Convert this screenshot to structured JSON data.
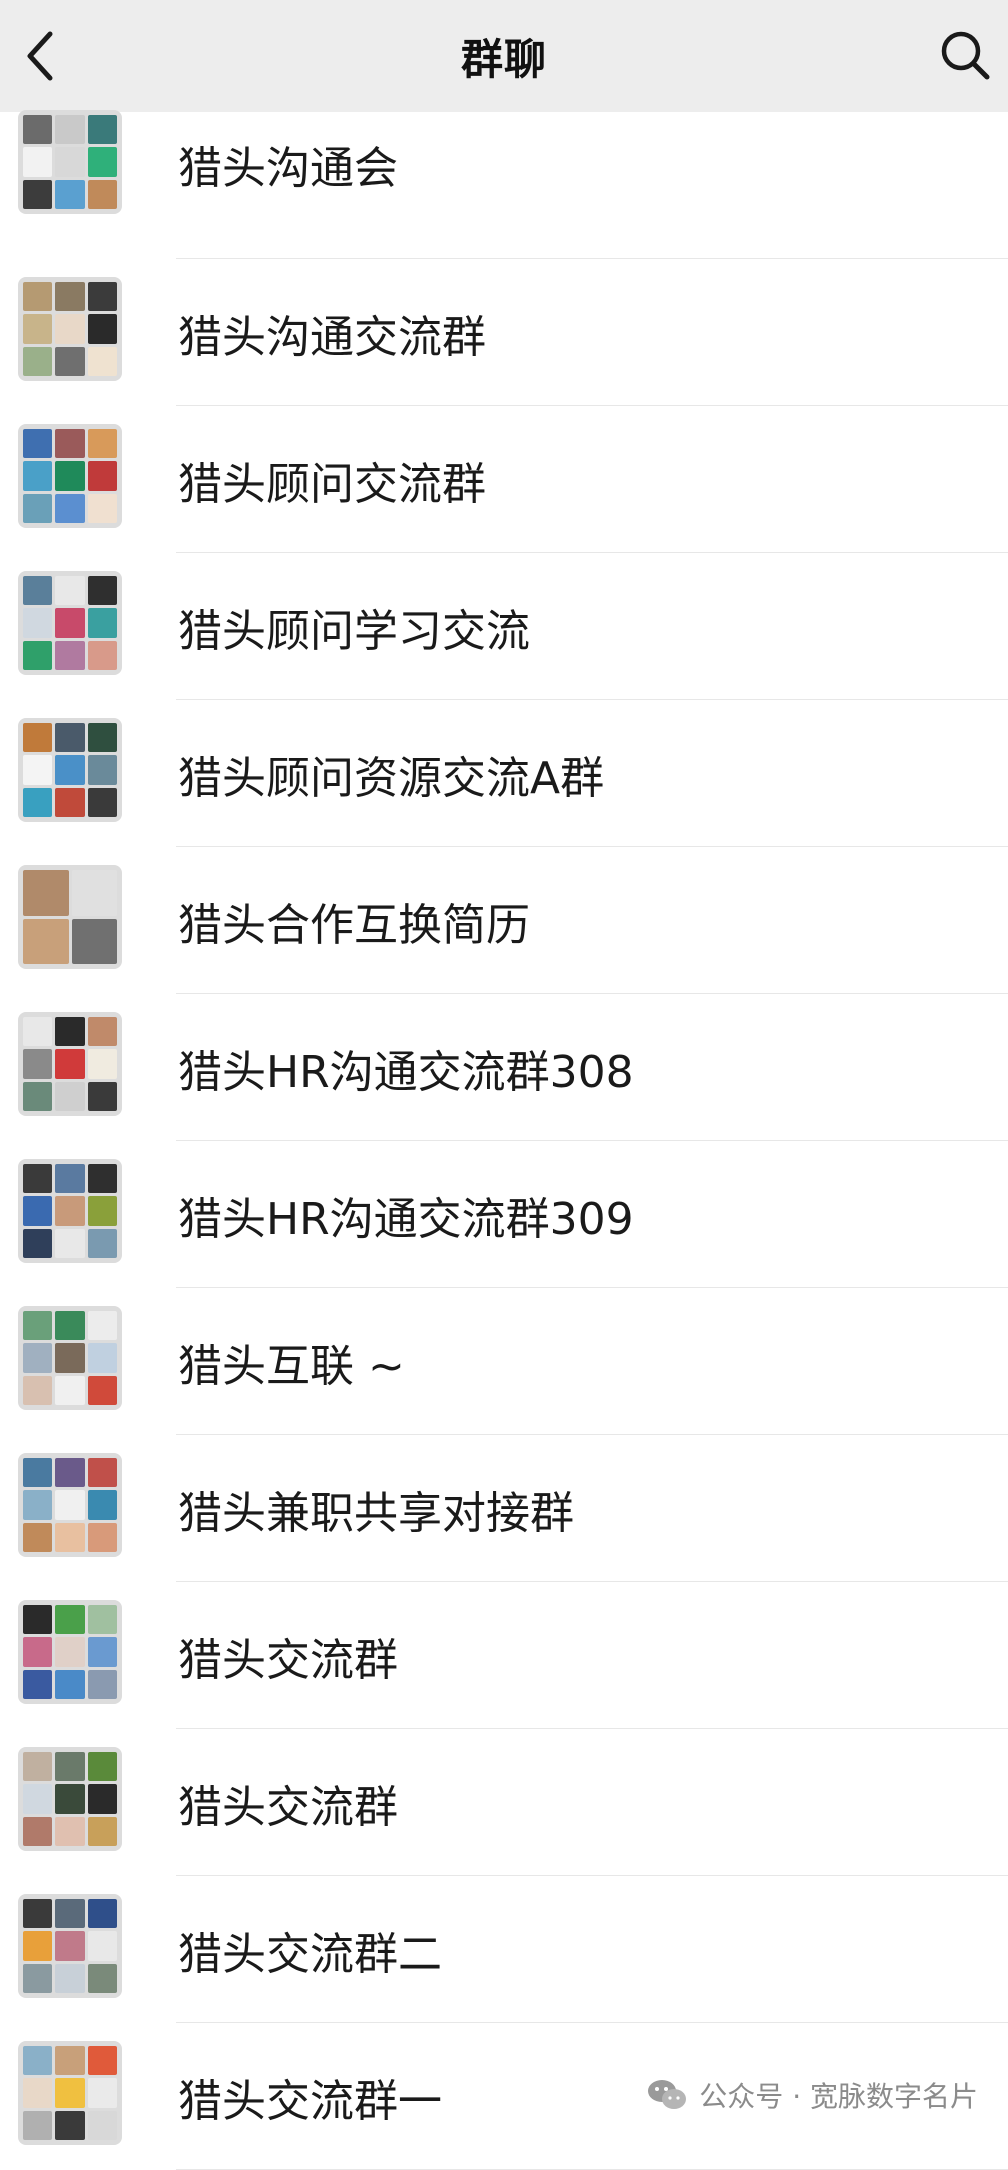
{
  "header": {
    "title": "群聊"
  },
  "groups": [
    {
      "name": "猎头沟通会",
      "colors": [
        "#6b6b6b",
        "#c9c9c9",
        "#3a7a7a",
        "#f2f2f2",
        "#d8d8d8",
        "#2fb07a",
        "#3c3c3c",
        "#5aa0d0",
        "#c08a5a"
      ]
    },
    {
      "name": "猎头沟通交流群",
      "colors": [
        "#b59a72",
        "#8a7a62",
        "#3b3b3b",
        "#c8b48a",
        "#e8d8c8",
        "#2a2a2a",
        "#9ab08a",
        "#6f6f6f",
        "#efe2d0"
      ]
    },
    {
      "name": "猎头顾问交流群",
      "colors": [
        "#3f6fb0",
        "#9a5a5a",
        "#d89a5a",
        "#4aa0c8",
        "#1f8a5a",
        "#c03a3a",
        "#6aa0b8",
        "#5b8fd0",
        "#f0e0d0"
      ]
    },
    {
      "name": "猎头顾问学习交流",
      "colors": [
        "#5a7f9a",
        "#e8e8e8",
        "#2f2f2f",
        "#d0d8e0",
        "#c84a6a",
        "#3aa0a0",
        "#2fa06a",
        "#b07aa0",
        "#d89a8a"
      ]
    },
    {
      "name": "猎头顾问资源交流A群",
      "colors": [
        "#c07a3a",
        "#4a5a6a",
        "#2f4f3f",
        "#f4f4f4",
        "#4a90c8",
        "#6a8a9a",
        "#39a0c0",
        "#c04a3a",
        "#3a3a3a"
      ]
    },
    {
      "name": "猎头合作互换简历",
      "colors": [
        "#b08a6a",
        "#e0e0e0",
        "#c8a07a",
        "#707070"
      ]
    },
    {
      "name": "猎头HR沟通交流群308",
      "colors": [
        "#e8e8e8",
        "#2a2a2a",
        "#c08a6a",
        "#8a8a8a",
        "#d03a3a",
        "#f0ebe0",
        "#6a8a7a",
        "#cfcfcf",
        "#3a3a3a"
      ]
    },
    {
      "name": "猎头HR沟通交流群309",
      "colors": [
        "#3a3a3a",
        "#5a7aa0",
        "#2f2f2f",
        "#3a6ab0",
        "#c89a7a",
        "#8aa03a",
        "#2f3f5a",
        "#e8e8e8",
        "#7a9ab0"
      ]
    },
    {
      "name": "猎头互联 ~",
      "colors": [
        "#6aa07a",
        "#3a8a5a",
        "#ececec",
        "#a0b0c0",
        "#7a6a5a",
        "#c0d0e0",
        "#d8c0b0",
        "#f0f0f0",
        "#d04a3a"
      ]
    },
    {
      "name": "猎头兼职共享对接群",
      "colors": [
        "#4a7aa0",
        "#6a5a8a",
        "#c0504a",
        "#8ab0c8",
        "#f0f0f0",
        "#3a8ab0",
        "#c08a5a",
        "#e8c0a0",
        "#d89a7a"
      ]
    },
    {
      "name": "猎头交流群",
      "colors": [
        "#2a2a2a",
        "#4aa04a",
        "#a0c0a0",
        "#c86a8a",
        "#e0d0c8",
        "#6a9ad0",
        "#3a5aa0",
        "#4a8ac8",
        "#8a9ab0"
      ]
    },
    {
      "name": "猎头交流群",
      "colors": [
        "#c0b0a0",
        "#6a7a6a",
        "#5a8a3a",
        "#d0d8e0",
        "#3a4a3a",
        "#2a2a2a",
        "#b07a6a",
        "#e0c0b0",
        "#c8a05a"
      ]
    },
    {
      "name": "猎头交流群二",
      "colors": [
        "#3a3a3a",
        "#5a6a7a",
        "#2f4f8a",
        "#e8a03a",
        "#c07a8a",
        "#e8e8e8",
        "#8a9aa0",
        "#c8d0d8",
        "#7a8a7a"
      ]
    },
    {
      "name": "猎头交流群一",
      "colors": [
        "#8ab0c8",
        "#c8a07a",
        "#e05a3a",
        "#e8d8c8",
        "#f0c040",
        "#eaeaea",
        "#b0b0b0",
        "#3a3a3a",
        "#d8d8d8"
      ]
    }
  ],
  "watermark": {
    "text": "公众号 · 宽脉数字名片"
  }
}
